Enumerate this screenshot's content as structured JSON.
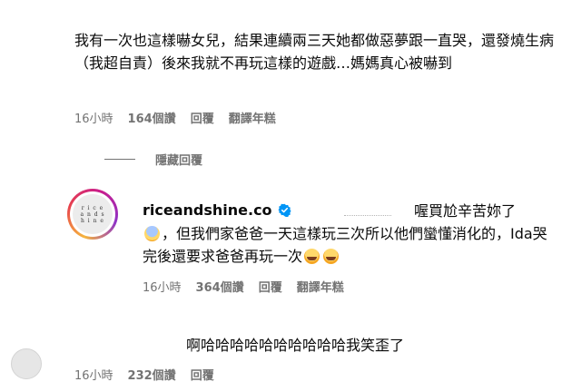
{
  "comment1": {
    "text": "我有一次也這樣嚇女兒，結果連續兩三天她都做惡夢跟一直哭，還發燒生病（我超自責）後來我就不再玩這樣的遊戲…媽媽真心被嚇到",
    "time": "16小時",
    "likes": "164個讚",
    "reply": "回覆",
    "translate": "翻譯年糕"
  },
  "hidden_replies": {
    "label": "隱藏回覆"
  },
  "comment2": {
    "avatar_text": "rice ands hine",
    "username": "riceandshine.co",
    "text_line1": "喔買尬辛苦妳了",
    "text_line2": "，但我們家爸爸一天這樣玩三次所以他們蠻懂消化的，Ida哭完後還要求爸爸再玩一次",
    "time": "16小時",
    "likes": "364個讚",
    "reply": "回覆",
    "translate": "翻譯年糕"
  },
  "comment3": {
    "avatar_text": "",
    "text": "啊哈哈哈哈哈哈哈哈哈哈我笑歪了",
    "time": "16小時",
    "likes": "232個讚",
    "reply": "回覆"
  },
  "colors": {
    "verified": "#0095f6",
    "meta": "#737373"
  }
}
